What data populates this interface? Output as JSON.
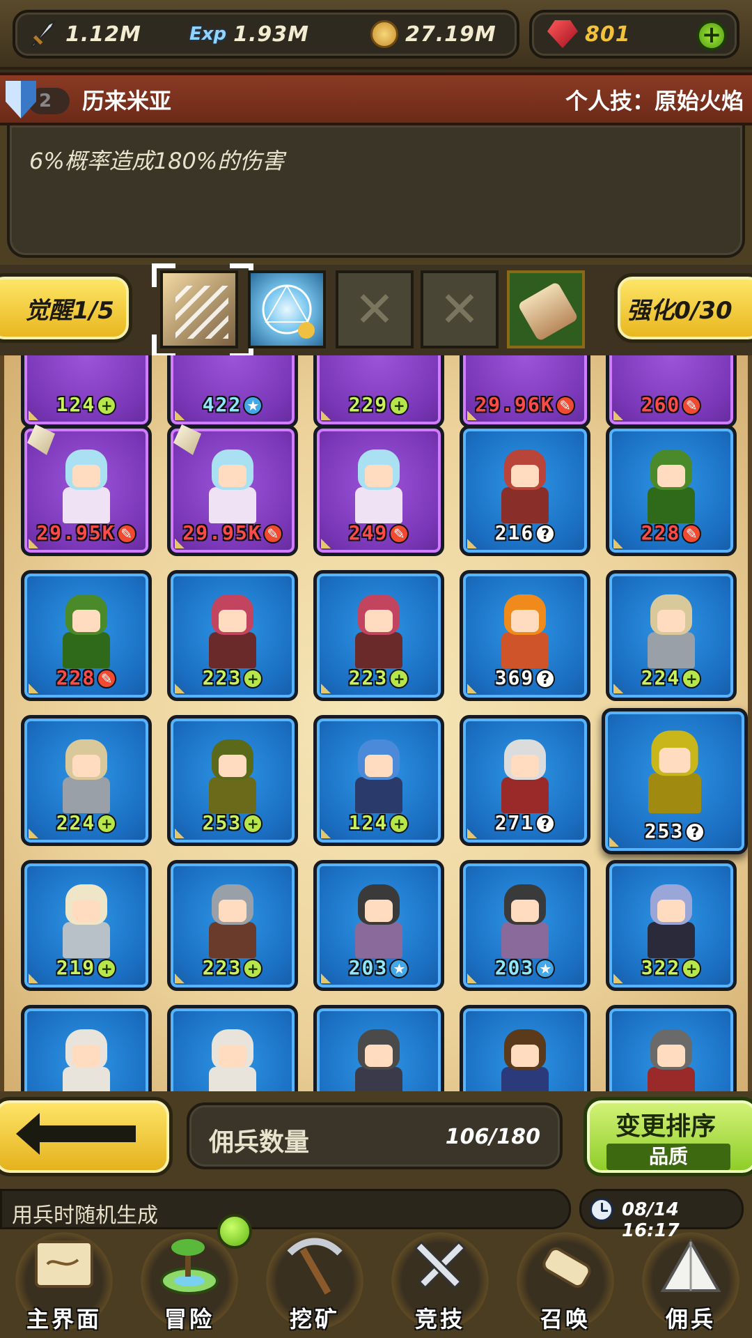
{
  "resources": {
    "attack": {
      "icon": "sword-icon",
      "value": "1.12M"
    },
    "exp": {
      "icon": "exp-icon",
      "label": "Exp",
      "value": "1.93M"
    },
    "gold": {
      "icon": "coin-icon",
      "value": "27.19M"
    },
    "ruby": {
      "icon": "ruby-icon",
      "value": "801"
    },
    "add_label": "+"
  },
  "hero": {
    "level": "2",
    "name": "历来米亚",
    "skill_title": "个人技：原始火焰",
    "skill_desc": "6%概率造成180%的伤害"
  },
  "skill_row": {
    "awaken_label": "觉醒1/5",
    "enhance_label": "强化0/30",
    "empty_slot_mark": "✕"
  },
  "mercenary_grid": {
    "rows": [
      [
        {
          "level": "124",
          "badge": "plus",
          "frame": "purple",
          "level_color": "green"
        },
        {
          "level": "422",
          "badge": "star",
          "frame": "purple",
          "level_color": "blue"
        },
        {
          "level": "229",
          "badge": "plus",
          "frame": "purple",
          "level_color": "green"
        },
        {
          "level": "29.96K",
          "badge": "fire",
          "frame": "purple",
          "level_color": "red"
        },
        {
          "level": "260",
          "badge": "fire",
          "frame": "purple",
          "level_color": "red"
        }
      ],
      [
        {
          "level": "29.95K",
          "badge": "fire",
          "frame": "purple",
          "level_color": "red",
          "crystal": true,
          "hair": "#a9e1f2",
          "robe": "#efe2f4"
        },
        {
          "level": "29.95K",
          "badge": "fire",
          "frame": "purple",
          "level_color": "red",
          "crystal": true,
          "hair": "#a9e1f2",
          "robe": "#efe2f4"
        },
        {
          "level": "249",
          "badge": "fire",
          "frame": "purple",
          "level_color": "red",
          "hair": "#a9e1f2",
          "robe": "#efe2f4"
        },
        {
          "level": "216",
          "badge": "q",
          "frame": "blue",
          "level_color": "white",
          "hair": "#b8443a",
          "robe": "#8a2e2a"
        },
        {
          "level": "228",
          "badge": "fire",
          "frame": "blue",
          "level_color": "red",
          "hair": "#4a8a2a",
          "robe": "#2f6a1a"
        }
      ],
      [
        {
          "level": "228",
          "badge": "fire",
          "frame": "blue",
          "level_color": "red",
          "hair": "#4a8a2a",
          "robe": "#2f6a1a"
        },
        {
          "level": "223",
          "badge": "plus",
          "frame": "blue",
          "level_color": "green",
          "hair": "#c2445e",
          "robe": "#6a2a2a"
        },
        {
          "level": "223",
          "badge": "plus",
          "frame": "blue",
          "level_color": "green",
          "hair": "#c2445e",
          "robe": "#6a2a2a"
        },
        {
          "level": "369",
          "badge": "q",
          "frame": "blue",
          "level_color": "white",
          "hair": "#f08a1a",
          "robe": "#d0542a"
        },
        {
          "level": "224",
          "badge": "plus",
          "frame": "blue",
          "level_color": "green",
          "hair": "#d8c89a",
          "robe": "#9aa0a8"
        }
      ],
      [
        {
          "level": "224",
          "badge": "plus",
          "frame": "blue",
          "level_color": "green",
          "hair": "#d8c89a",
          "robe": "#9aa0a8"
        },
        {
          "level": "253",
          "badge": "plus",
          "frame": "blue",
          "level_color": "green",
          "hair": "#5a6a1a",
          "robe": "#6a6a1a"
        },
        {
          "level": "124",
          "badge": "plus",
          "frame": "blue",
          "level_color": "green",
          "hair": "#4a8ad8",
          "robe": "#2a3a6a"
        },
        {
          "level": "271",
          "badge": "q",
          "frame": "blue",
          "level_color": "white",
          "hair": "#dcdcdc",
          "robe": "#9a2a2a"
        },
        {
          "level": "253",
          "badge": "q",
          "frame": "blue",
          "level_color": "white",
          "hair": "#c8b61a",
          "robe": "#a08a10",
          "big": true
        }
      ],
      [
        {
          "level": "219",
          "badge": "plus",
          "frame": "blue",
          "level_color": "green",
          "hair": "#efe6c8",
          "robe": "#b8c0c8"
        },
        {
          "level": "223",
          "badge": "plus",
          "frame": "blue",
          "level_color": "green",
          "hair": "#9aa0a8",
          "robe": "#6a3a2a"
        },
        {
          "level": "203",
          "badge": "star",
          "frame": "blue",
          "level_color": "blue",
          "hair": "#3a3a3a",
          "robe": "#8a6a9a"
        },
        {
          "level": "203",
          "badge": "star",
          "frame": "blue",
          "level_color": "blue",
          "hair": "#3a3a3a",
          "robe": "#8a6a9a"
        },
        {
          "level": "322",
          "badge": "plus",
          "frame": "blue",
          "level_color": "green",
          "hair": "#9aa6d8",
          "robe": "#2a2a3a"
        }
      ],
      [
        {
          "level": "",
          "badge": "",
          "frame": "blue",
          "level_color": "white",
          "hair": "#e8e4dc",
          "robe": "#e8e4dc"
        },
        {
          "level": "",
          "badge": "",
          "frame": "blue",
          "level_color": "white",
          "hair": "#e8e4dc",
          "robe": "#e8e4dc"
        },
        {
          "level": "",
          "badge": "",
          "frame": "blue",
          "level_color": "white",
          "hair": "#4a4a4a",
          "robe": "#3a3a4a"
        },
        {
          "level": "",
          "badge": "",
          "frame": "blue",
          "level_color": "white",
          "hair": "#5a3a1a",
          "robe": "#2a3a7a"
        },
        {
          "level": "",
          "badge": "",
          "frame": "blue",
          "level_color": "white",
          "hair": "#6a6a6a",
          "robe": "#9a2a2a"
        }
      ]
    ]
  },
  "bottom": {
    "count_label": "佣兵数量",
    "count_value": "106/180",
    "sort_label": "变更排序",
    "sort_mode": "品质",
    "ticker": "用兵时随机生成",
    "datetime": "08/14 16:17"
  },
  "nav": [
    {
      "label": "主界面",
      "icon": "map-icon"
    },
    {
      "label": "冒险",
      "icon": "island-icon"
    },
    {
      "label": "挖矿",
      "icon": "pickaxe-icon"
    },
    {
      "label": "竞技",
      "icon": "crossed-swords-icon"
    },
    {
      "label": "召唤",
      "icon": "scroll-icon"
    },
    {
      "label": "佣兵",
      "icon": "tent-icon"
    }
  ],
  "badge_glyphs": {
    "plus": "+",
    "star": "★",
    "fire": "✎",
    "q": "?"
  },
  "colors": {
    "blue_frame": "#1b6fc3",
    "purple_frame": "#7a37b8",
    "accent_yellow": "#f2c23a",
    "accent_green": "#8ccc26"
  }
}
